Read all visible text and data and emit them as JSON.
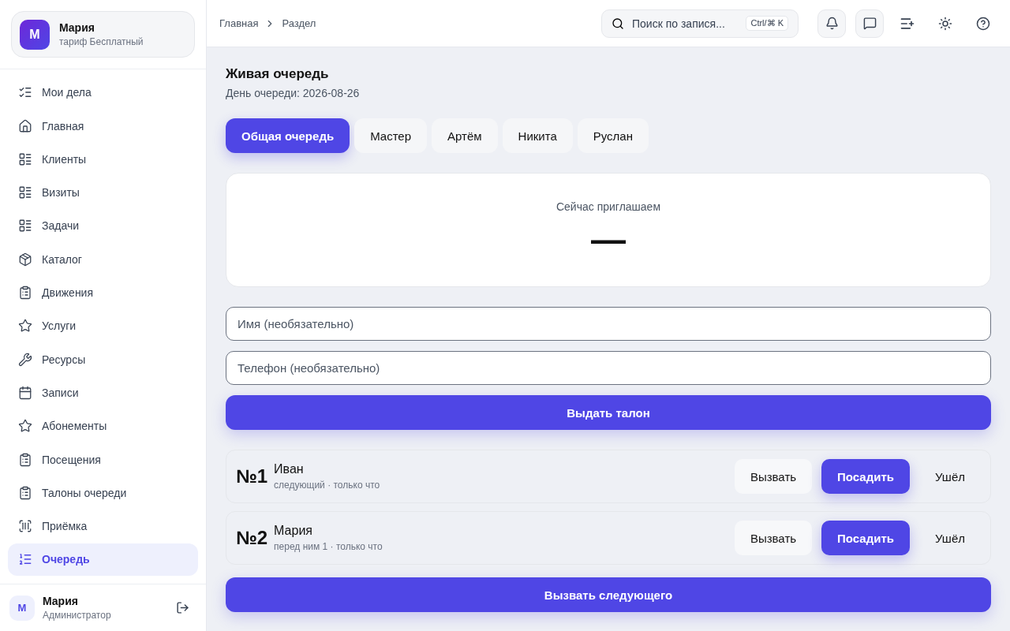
{
  "profile": {
    "avatar": "М",
    "name": "Мария",
    "plan": "тариф Бесплатный"
  },
  "sidebar": {
    "items": [
      {
        "label": "Мои дела",
        "selected": false
      },
      {
        "label": "Главная",
        "selected": false
      },
      {
        "label": "Клиенты",
        "selected": false
      },
      {
        "label": "Визиты",
        "selected": false
      },
      {
        "label": "Задачи",
        "selected": false
      },
      {
        "label": "Каталог",
        "selected": false
      },
      {
        "label": "Движения",
        "selected": false
      },
      {
        "label": "Услуги",
        "selected": false
      },
      {
        "label": "Ресурсы",
        "selected": false
      },
      {
        "label": "Записи",
        "selected": false
      },
      {
        "label": "Абонементы",
        "selected": false
      },
      {
        "label": "Посещения",
        "selected": false
      },
      {
        "label": "Талоны очереди",
        "selected": false
      },
      {
        "label": "Приёмка",
        "selected": false
      },
      {
        "label": "Очередь",
        "selected": true
      }
    ]
  },
  "user": {
    "avatar": "М",
    "name": "Мария",
    "role": "Администратор"
  },
  "breadcrumbs": [
    "Главная",
    "Раздел"
  ],
  "search": {
    "placeholder": "Поиск по запися...",
    "shortcut": "Ctrl/⌘ K"
  },
  "page": {
    "title": "Живая очередь",
    "subtitle": "День очереди: 2026-08-26"
  },
  "tabs": [
    {
      "label": "Общая очередь",
      "selected": true
    },
    {
      "label": "Мастер",
      "selected": false
    },
    {
      "label": "Артём",
      "selected": false
    },
    {
      "label": "Никита",
      "selected": false
    },
    {
      "label": "Руслан",
      "selected": false
    }
  ],
  "current": {
    "label": "Сейчас приглашаем",
    "number": "—"
  },
  "form": {
    "name_placeholder": "Имя (необязательно)",
    "phone_placeholder": "Телефон (необязательно)",
    "submit": "Выдать талон"
  },
  "tickets": [
    {
      "number": "№1",
      "name": "Иван",
      "meta": "следующий · только что",
      "actions": [
        "Вызвать",
        "Посадить",
        "Ушёл"
      ]
    },
    {
      "number": "№2",
      "name": "Мария",
      "meta": "перед ним 1 · только что",
      "actions": [
        "Вызвать",
        "Посадить",
        "Ушёл"
      ]
    }
  ],
  "call_next": "Вызвать следующего"
}
